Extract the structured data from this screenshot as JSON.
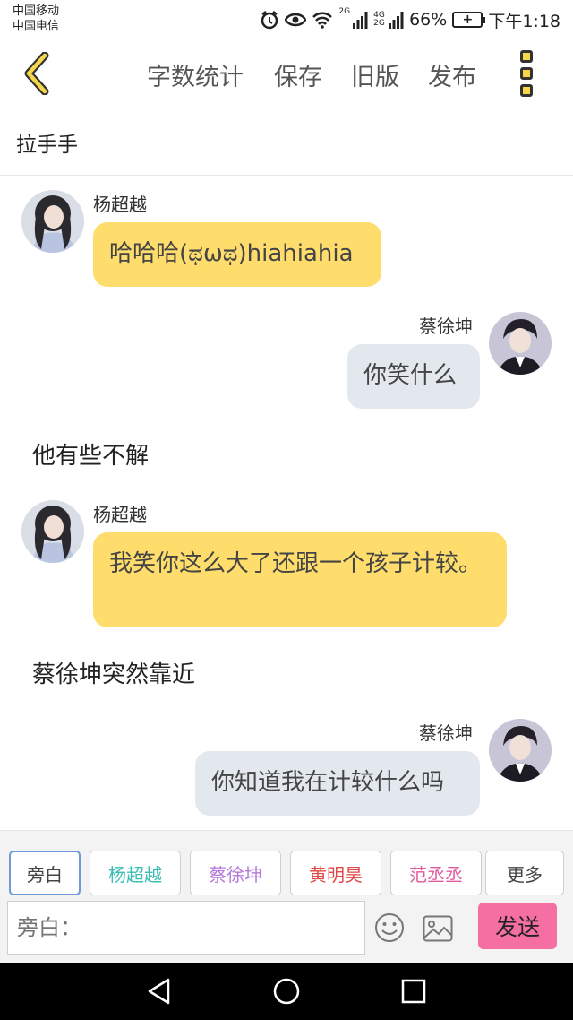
{
  "status": {
    "carrier1": "中国移动",
    "carrier2": "中国电信",
    "net1": "2G",
    "net2": "4G 2G",
    "battery_percent": "66%",
    "time": "下午1:18"
  },
  "toolbar": {
    "word_count": "字数统计",
    "save": "保存",
    "old_version": "旧版",
    "publish": "发布"
  },
  "chapter_title": "拉手手",
  "messages": [
    {
      "type": "left",
      "speaker": "杨超越",
      "text": "哈哈哈(ಥωಥ)hiahiahia"
    },
    {
      "type": "right",
      "speaker": "蔡徐坤",
      "text": "你笑什么"
    },
    {
      "type": "narration",
      "text": "他有些不解"
    },
    {
      "type": "left",
      "speaker": "杨超越",
      "text": "我笑你这么大了还跟一个孩子计较。"
    },
    {
      "type": "narration",
      "text": "蔡徐坤突然靠近"
    },
    {
      "type": "right",
      "speaker": "蔡徐坤",
      "text": "你知道我在计较什么吗"
    }
  ],
  "roles": [
    "旁白",
    "杨超越",
    "蔡徐坤",
    "黄明昊",
    "范丞丞",
    "更多"
  ],
  "role_colors": [
    "#444444",
    "#3bbcb4",
    "#b47ad8",
    "#e04848",
    "#e05aa0",
    "#444444"
  ],
  "input": {
    "placeholder": "旁白："
  },
  "send_label": "发送",
  "colors": {
    "yellow_bubble": "#fedd6c",
    "blue_bubble": "#e3e8ef",
    "send": "#f56fa3",
    "accent": "#f6d64a"
  }
}
